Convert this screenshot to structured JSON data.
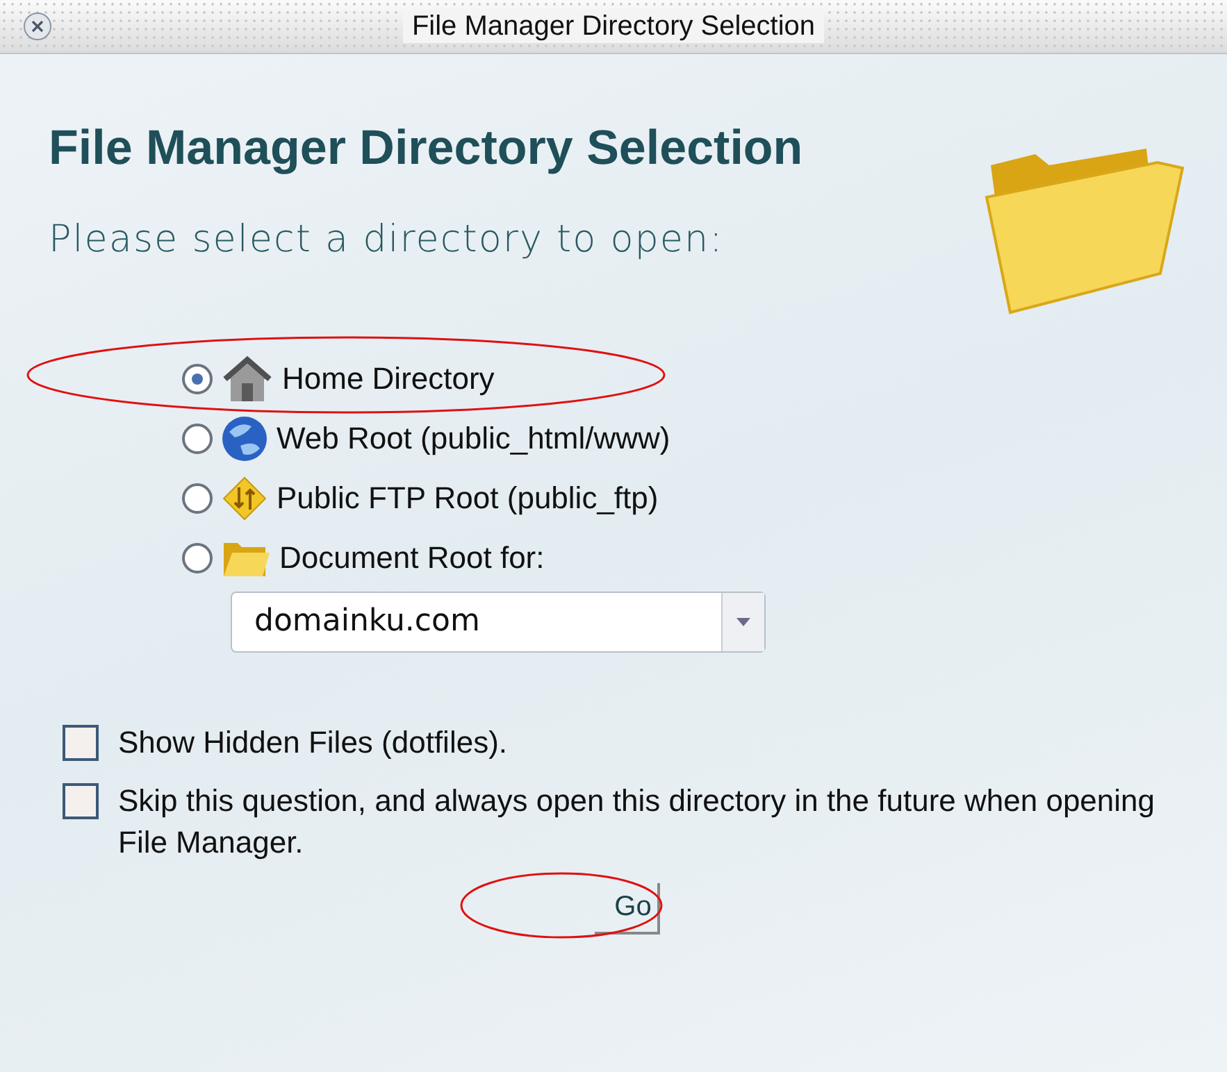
{
  "window": {
    "title": "File Manager Directory Selection"
  },
  "heading": "File Manager Directory Selection",
  "prompt": "Please select a directory to open:",
  "directories": [
    {
      "kind": "home",
      "label": "Home Directory",
      "selected": true
    },
    {
      "kind": "web",
      "label": "Web Root (public_html/www)",
      "selected": false
    },
    {
      "kind": "ftp",
      "label": "Public FTP Root (public_ftp)",
      "selected": false
    },
    {
      "kind": "docroot",
      "label": "Document Root for:",
      "selected": false
    }
  ],
  "domain_select": {
    "value": "domainku.com"
  },
  "options": [
    {
      "label": "Show Hidden Files (dotfiles).",
      "checked": false
    },
    {
      "label": "Skip this question, and always open this directory in the future when opening File Manager.",
      "checked": false
    }
  ],
  "go_button": "Go"
}
